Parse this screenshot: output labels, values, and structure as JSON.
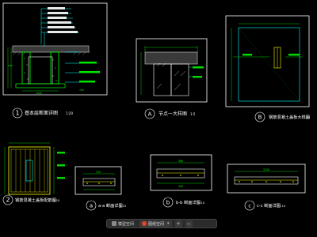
{
  "drawings": {
    "d1": {
      "mark": "1",
      "title": "基本层断面详图",
      "scale": "1:20",
      "dims": [
        "400",
        "120",
        "400",
        "100",
        "50",
        "400",
        "1500",
        "100",
        "700",
        "100"
      ]
    },
    "dA": {
      "mark": "A",
      "title": "节点一大样图",
      "scale": "1:5"
    },
    "dB": {
      "mark": "B",
      "title": "钢筋混凝土盖板大样图",
      "scale": "1:10"
    },
    "d2": {
      "mark": "2",
      "title": "钢筋混凝土盖板配筋图",
      "scale": "1:20"
    },
    "da": {
      "mark": "a",
      "title": "a-a 断面详图",
      "scale": "1:10",
      "dims": [
        "60",
        "120",
        "60",
        "120",
        "60"
      ]
    },
    "db": {
      "mark": "b",
      "title": "b-b 断面详图",
      "scale": "1:10",
      "dims": [
        "60",
        "440",
        "60",
        "560"
      ]
    },
    "dc": {
      "mark": "c",
      "title": "c-c 断面详图",
      "scale": "1:10",
      "dims": [
        "1210"
      ]
    }
  },
  "colors": {
    "frame": "#ffffff",
    "concrete": "#00ff00",
    "leader": "#00ffff",
    "rebar": "#ffff00",
    "dim": "#00ff00",
    "ground": "#9a9a9a"
  },
  "taskbar": {
    "items": [
      {
        "label": "模型空间",
        "icon": "grey",
        "active": false
      },
      {
        "label": "图纸空间",
        "icon": "red",
        "active": true
      }
    ],
    "buttons": [
      "+",
      "−"
    ]
  }
}
